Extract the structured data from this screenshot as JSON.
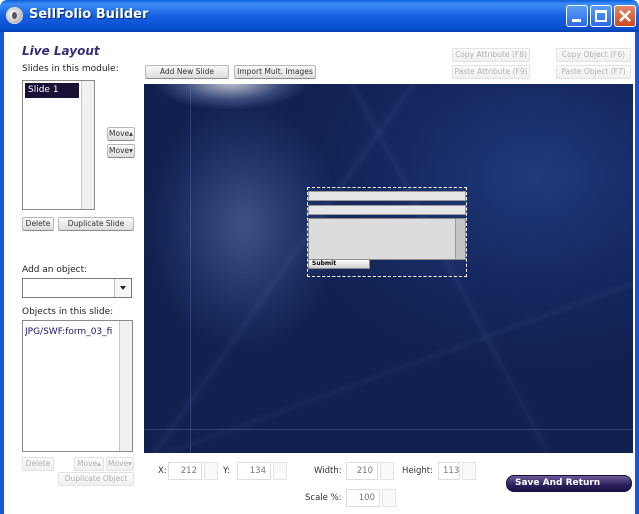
{
  "window": {
    "title": "SellFolio Builder"
  },
  "left": {
    "heading": "Live Layout",
    "slides_label": "Slides in this module:",
    "slides": [
      "Slide 1"
    ],
    "move_up": "Move▴",
    "move_down": "Move▾",
    "delete": "Delete",
    "duplicate_slide": "Duplicate Slide",
    "add_object_label": "Add an object:",
    "objects_label": "Objects in this slide:",
    "objects": [
      "JPG/SWF:form_03_fi"
    ],
    "obj_delete": "Delete",
    "obj_move_up": "Move▴",
    "obj_move_down": "Move▾",
    "duplicate_object": "Duplicate Object"
  },
  "toolbar": {
    "add_new_slide": "Add New Slide",
    "import_images": "Import Mult. Images",
    "copy_attribute": "Copy Attribute (F8)",
    "paste_attribute": "Paste Attribute (F9)",
    "copy_object": "Copy Object (F6)",
    "paste_object": "Paste Object (F7)"
  },
  "stage": {
    "submit_label": "Submit"
  },
  "props": {
    "x_label": "X:",
    "x": "212",
    "y_label": "Y:",
    "y": "134",
    "width_label": "Width:",
    "width": "210",
    "height_label": "Height:",
    "height": "113",
    "scale_label": "Scale %:",
    "scale": "100"
  },
  "save_and_return": "Save And Return"
}
